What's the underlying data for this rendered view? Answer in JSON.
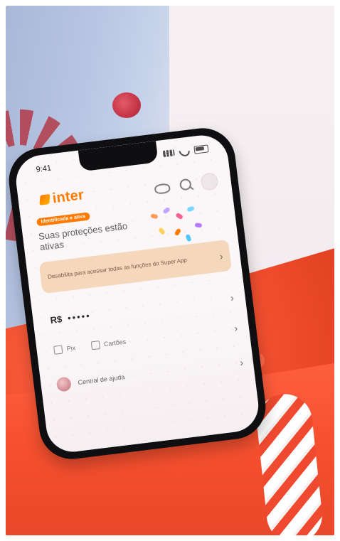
{
  "phone": {
    "status_time": "9:41",
    "logo_text": "inter",
    "promo": {
      "badge": "Identificada e ativa",
      "title": "Suas proteções estão ativas"
    },
    "notice": {
      "text": "Desabilita para acessar todas as funções do Super App"
    },
    "balance": {
      "currency": "R$",
      "masked": "•••••"
    },
    "shortcuts": [
      {
        "label": "Pix"
      },
      {
        "label": "Cartões"
      }
    ],
    "help": {
      "label": "Central de ajuda"
    }
  }
}
